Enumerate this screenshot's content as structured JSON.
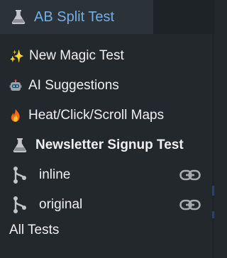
{
  "header": {
    "title": "AB Split Test"
  },
  "menu": {
    "new_magic_test": {
      "icon": "sparkles-icon",
      "label": "New Magic Test"
    },
    "ai_suggestions": {
      "icon": "robot-icon",
      "label": "AI Suggestions"
    },
    "heat_maps": {
      "icon": "fire-icon",
      "label": "Heat/Click/Scroll Maps"
    },
    "current_test": {
      "icon": "flask-icon",
      "label": "Newsletter Signup Test"
    },
    "variants": [
      {
        "icon": "branch-icon",
        "label": "inline",
        "action_icon": "link-icon"
      },
      {
        "icon": "branch-icon",
        "label": "original",
        "action_icon": "link-icon"
      }
    ],
    "all_tests": {
      "label": "All Tests"
    }
  },
  "colors": {
    "background": "#23282d",
    "header_bg": "#2c3338",
    "title": "#72aee6",
    "text": "#f0f0f1",
    "icon_gray": "#a7aaad"
  }
}
